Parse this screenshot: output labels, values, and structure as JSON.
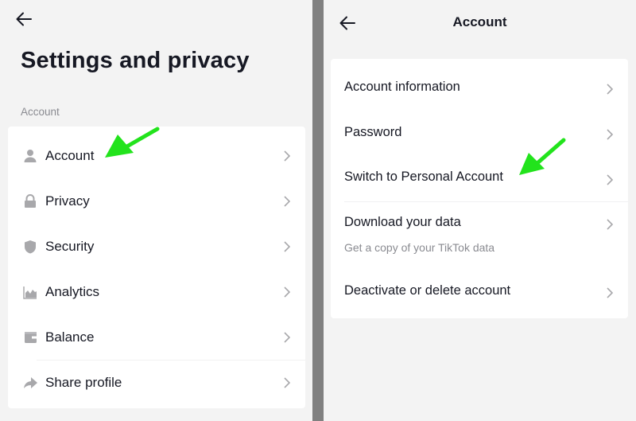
{
  "left": {
    "title": "Settings and privacy",
    "section_label": "Account",
    "items": [
      {
        "label": "Account",
        "icon": "person-icon"
      },
      {
        "label": "Privacy",
        "icon": "lock-icon"
      },
      {
        "label": "Security",
        "icon": "shield-icon"
      },
      {
        "label": "Analytics",
        "icon": "analytics-icon"
      },
      {
        "label": "Balance",
        "icon": "wallet-icon"
      },
      {
        "label": "Share profile",
        "icon": "share-icon"
      }
    ]
  },
  "right": {
    "title": "Account",
    "items": [
      {
        "label": "Account information"
      },
      {
        "label": "Password"
      },
      {
        "label": "Switch to Personal Account"
      },
      {
        "label": "Download your data",
        "subtitle": "Get a copy of your TikTok data"
      },
      {
        "label": "Deactivate or delete account"
      }
    ]
  },
  "colors": {
    "annotation_arrow": "#22e31c",
    "icon_gray": "#a8a8ab",
    "divider": "#808080"
  }
}
